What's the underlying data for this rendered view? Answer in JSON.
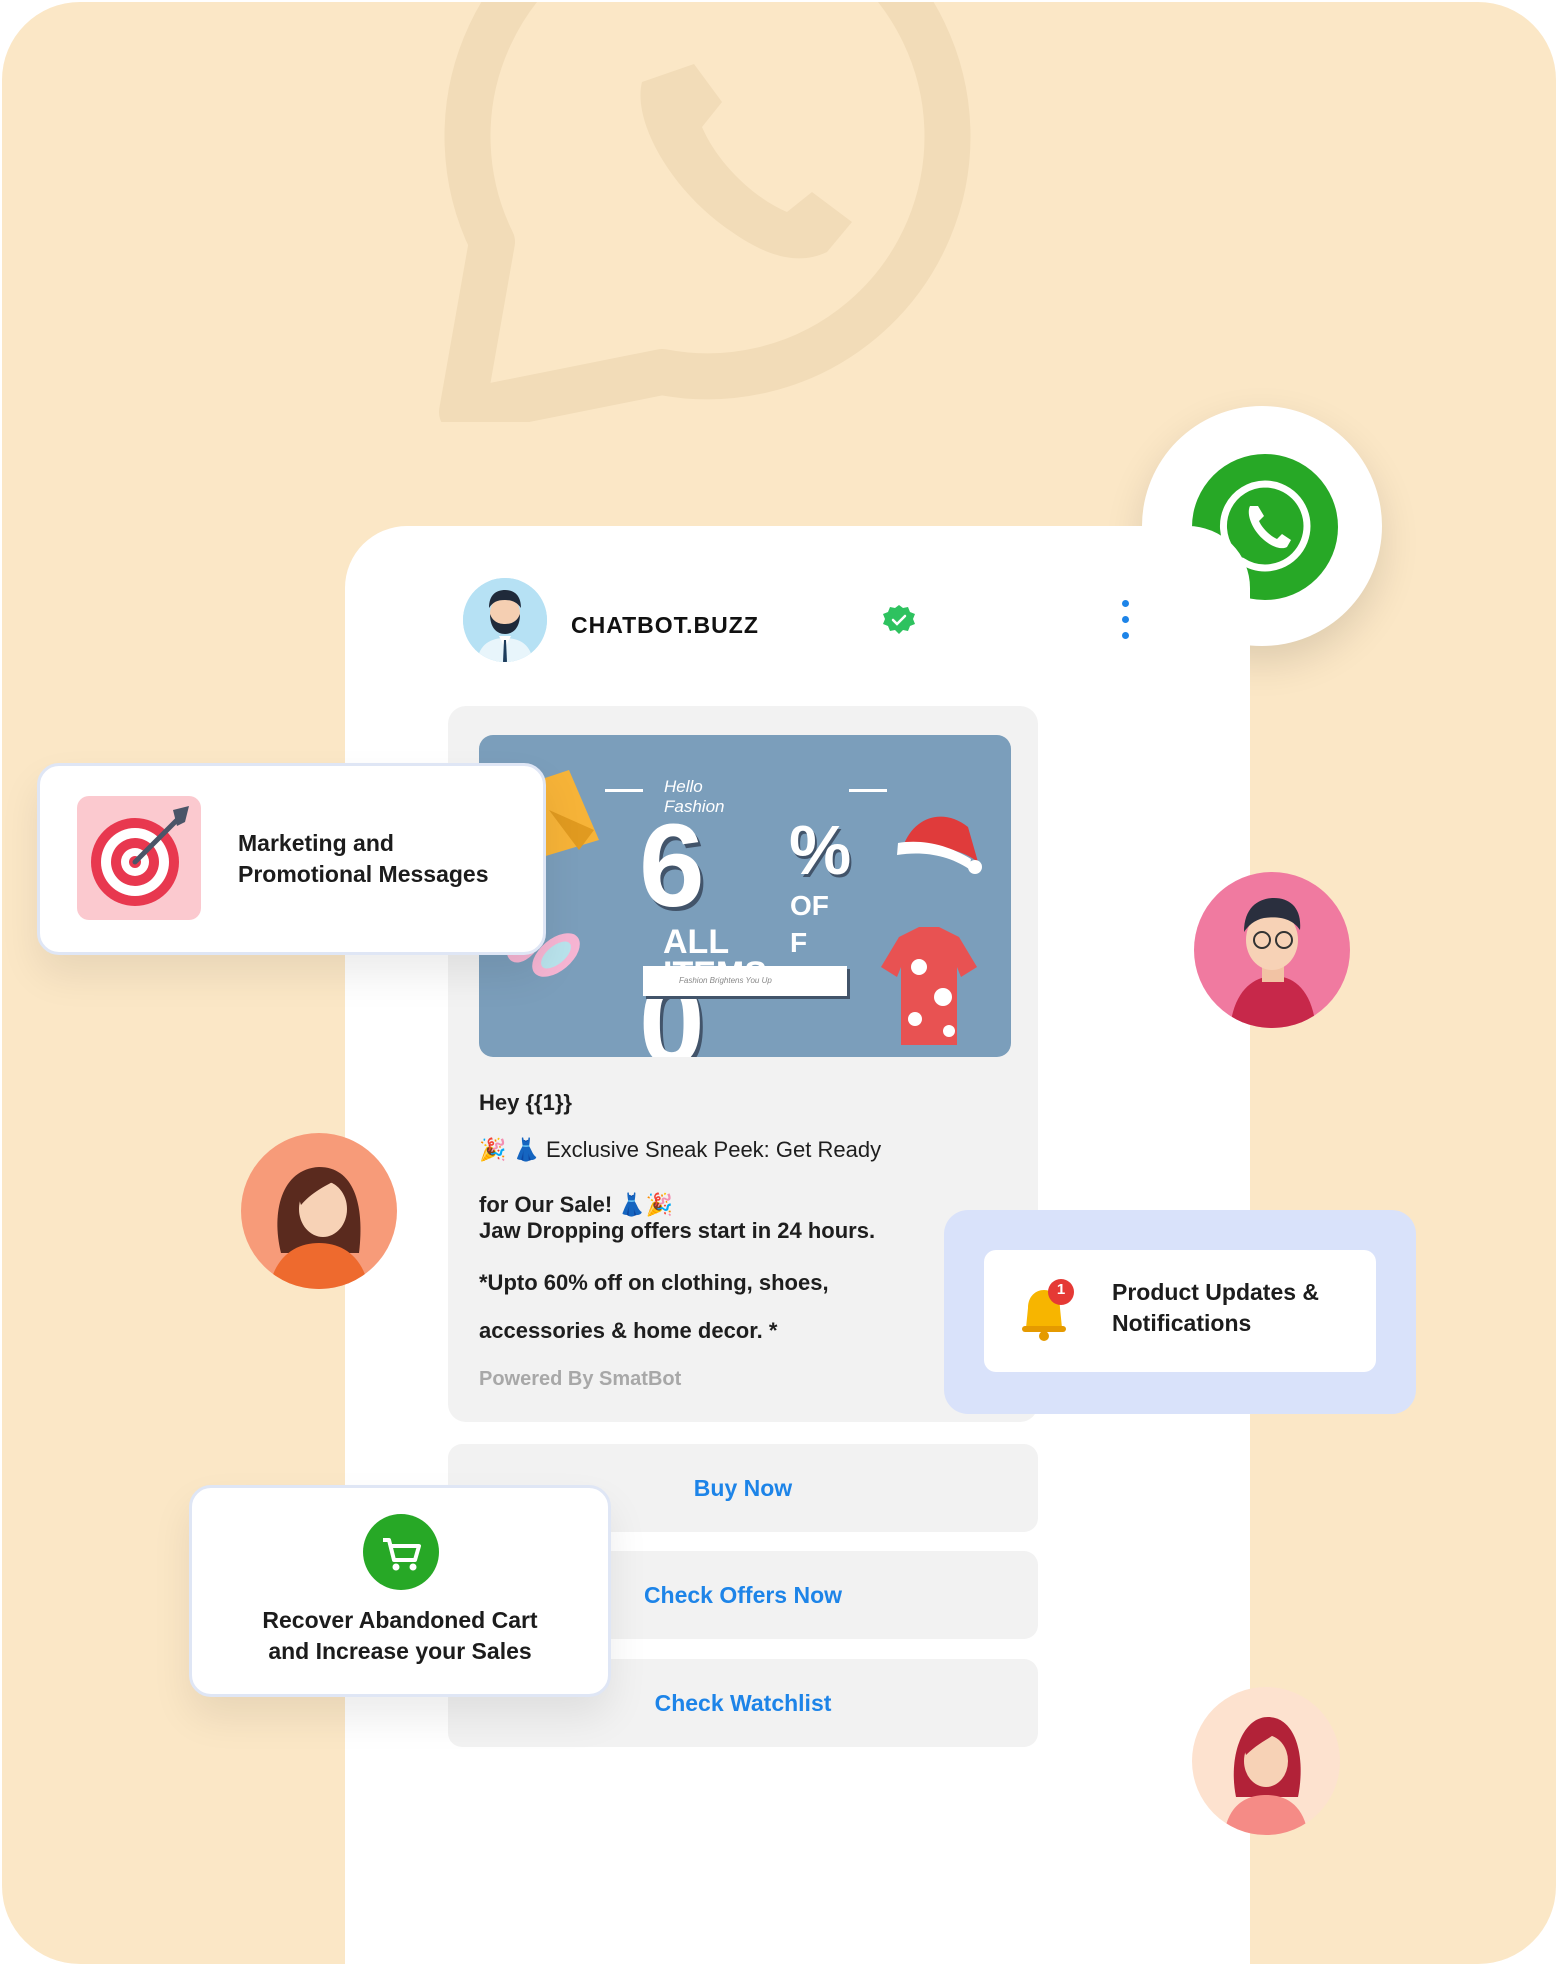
{
  "header": {
    "brand_name": "CHATBOT.BUZZ"
  },
  "banner": {
    "greeting_line1": "Hello",
    "greeting_line2": "Fashion",
    "digit_top": "6",
    "digit_bottom": "0",
    "percent": "%",
    "off_part1": "OF",
    "off_part2": "F",
    "all": "ALL",
    "items": "ITEMS",
    "tagline": "Fashion Brightens You Up"
  },
  "message": {
    "greeting": "Hey {{1}}",
    "line1": "🎉 👗 Exclusive Sneak Peek: Get Ready",
    "line2": "for Our Sale! 👗🎉",
    "line3": "Jaw Dropping offers start in 24 hours.",
    "line4": "*Upto 60% off on clothing, shoes,",
    "line5": "accessories & home decor. *",
    "powered_by": "Powered By SmatBot"
  },
  "buttons": {
    "buy_now": "Buy Now",
    "check_offers": "Check Offers Now",
    "check_watchlist": "Check Watchlist"
  },
  "features": {
    "marketing_line1": "Marketing and",
    "marketing_line2": "Promotional Messages",
    "product_updates_line1": "Product Updates &",
    "product_updates_line2": "Notifications",
    "notification_count": "1",
    "cart_line1": "Recover Abandoned Cart",
    "cart_line2": "and Increase your Sales"
  },
  "colors": {
    "background": "#fbe7c6",
    "accent_blue": "#1d84e8",
    "whatsapp_green": "#27a826",
    "verified_green": "#2ec25f"
  },
  "icons": [
    "whatsapp-icon",
    "verified-badge-icon",
    "kebab-menu-icon",
    "target-icon",
    "bell-icon",
    "cart-icon"
  ]
}
